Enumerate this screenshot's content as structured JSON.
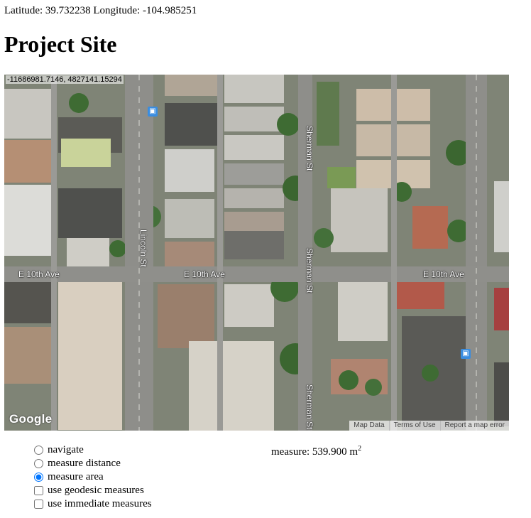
{
  "coordinates_text": "Latitude: 39.732238 Longitude: -104.985251",
  "page_title": "Project Site",
  "map": {
    "projected_coords": "-11686981.7146, 4827141.15294",
    "street_labels": {
      "lincoln": "Lincoln St",
      "sherman_top": "Sherman St",
      "sherman_mid": "Sherman St",
      "sherman_bottom": "Sherman St",
      "tenth_left": "E 10th Ave",
      "tenth_mid": "E 10th Ave",
      "tenth_right": "E 10th Ave"
    },
    "logo": "Google",
    "footer": {
      "map_data": "Map Data",
      "terms": "Terms of Use",
      "report": "Report a map error"
    },
    "icons": [
      "bus-stop-icon",
      "bus-stop-icon"
    ]
  },
  "controls": {
    "options": [
      {
        "label": "navigate",
        "type": "radio",
        "checked": false
      },
      {
        "label": "measure distance",
        "type": "radio",
        "checked": false
      },
      {
        "label": "measure area",
        "type": "radio",
        "checked": true
      },
      {
        "label": "use geodesic measures",
        "type": "checkbox",
        "checked": false
      },
      {
        "label": "use immediate measures",
        "type": "checkbox",
        "checked": false
      }
    ]
  },
  "measure": {
    "label": "measure: 539.900 m",
    "exponent": "2"
  },
  "colors": {
    "road": "#8e8e8a",
    "roof_light": "#c9c9c4",
    "roof_dark": "#6b6b68",
    "tree": "#3e6b33",
    "grass": "#7a9a55",
    "radio_accent": "#2f7fd8"
  }
}
